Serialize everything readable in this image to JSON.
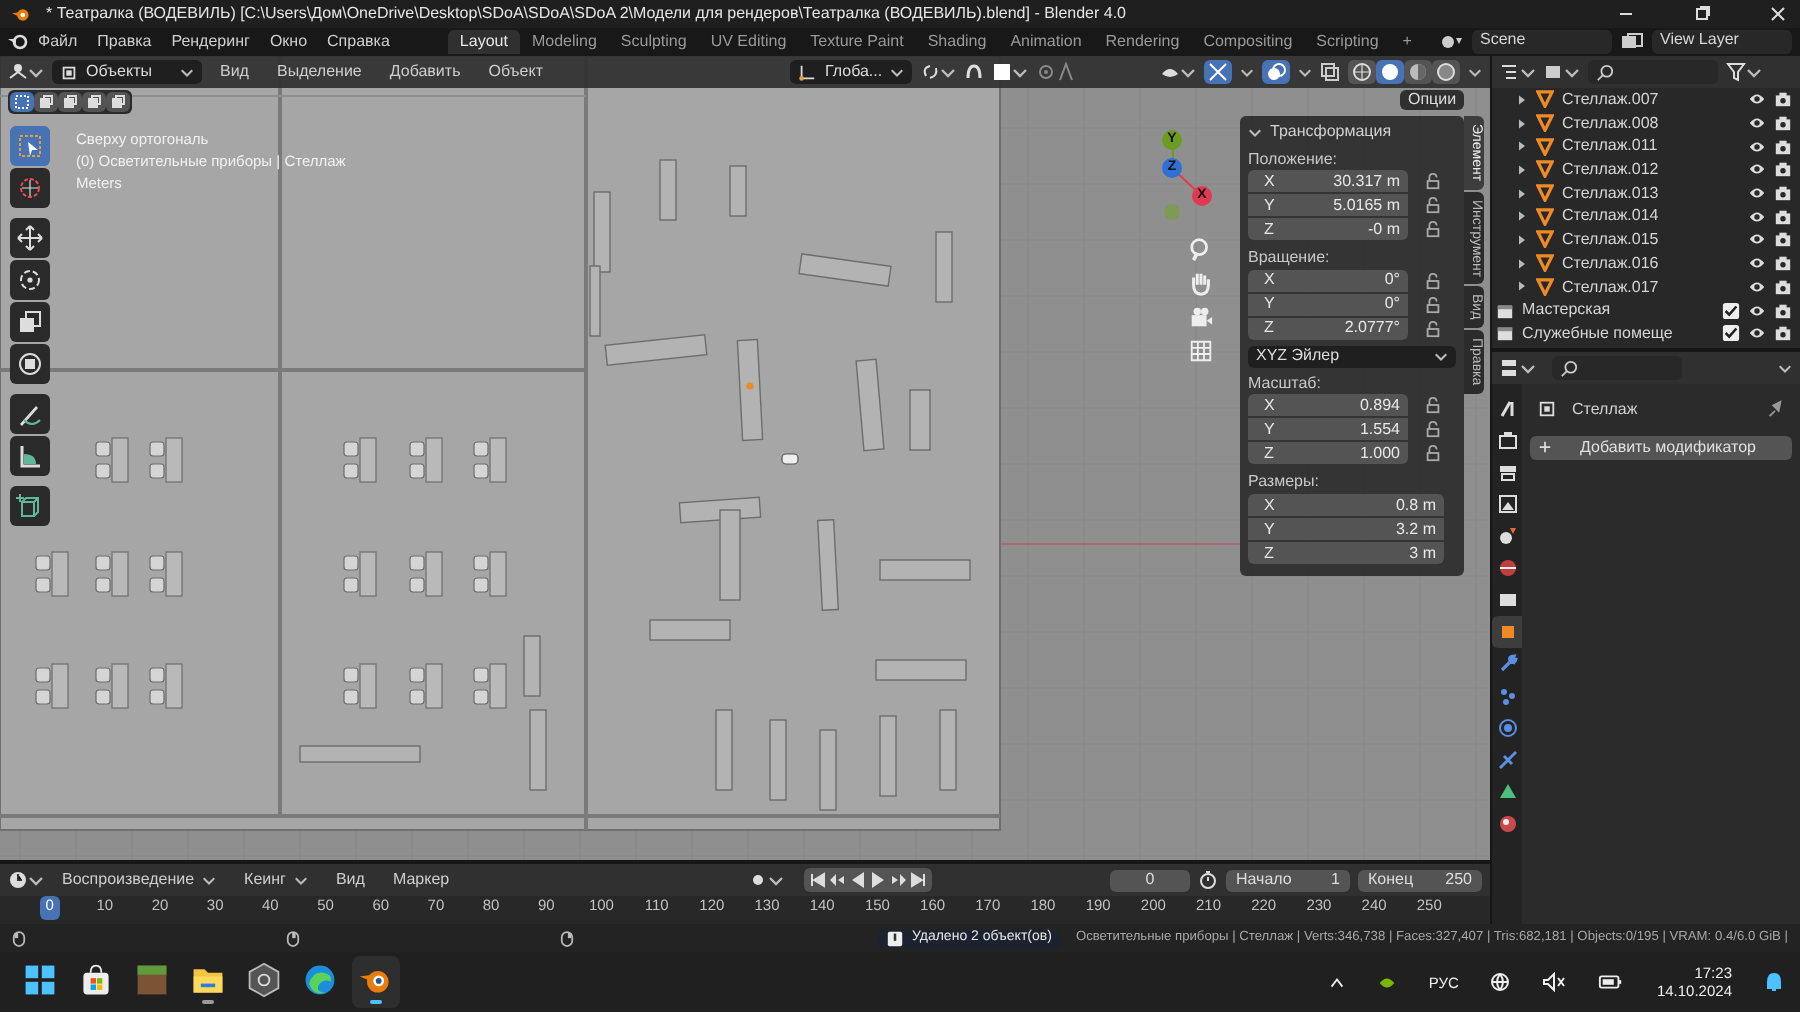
{
  "window": {
    "title": "* Театралка (ВОДЕВИЛЬ) [C:\\Users\\Дом\\OneDrive\\Desktop\\SDoA\\SDoA\\SDoA 2\\Модели для рендеров\\Театралка (ВОДЕВИЛЬ).blend] - Blender 4.0"
  },
  "menu": [
    "Файл",
    "Правка",
    "Рендеринг",
    "Окно",
    "Справка"
  ],
  "workspaces": [
    {
      "label": "Layout",
      "selected": true
    },
    {
      "label": "Modeling",
      "selected": false
    },
    {
      "label": "Sculpting",
      "selected": false
    },
    {
      "label": "UV Editing",
      "selected": false
    },
    {
      "label": "Texture Paint",
      "selected": false
    },
    {
      "label": "Shading",
      "selected": false
    },
    {
      "label": "Animation",
      "selected": false
    },
    {
      "label": "Rendering",
      "selected": false
    },
    {
      "label": "Compositing",
      "selected": false
    },
    {
      "label": "Scripting",
      "selected": false
    }
  ],
  "add_workspace": "+",
  "scene": {
    "name": "Scene"
  },
  "view_layer": {
    "name": "View Layer"
  },
  "viewport": {
    "mode": "Объекты",
    "menu": [
      "Вид",
      "Выделение",
      "Добавить",
      "Объект"
    ],
    "orientation": "Глоба...",
    "options": "Опции",
    "select_modes": [
      {
        "selected": true
      },
      {
        "selected": false
      },
      {
        "selected": false
      },
      {
        "selected": false
      },
      {
        "selected": false
      }
    ],
    "shading": [
      {
        "selected": false
      },
      {
        "selected": true
      },
      {
        "selected": false
      },
      {
        "selected": false
      }
    ],
    "overlay_text": [
      "Сверху ортогональ",
      "(0) Осветительные приборы | Стеллаж",
      "Meters"
    ],
    "tools": [
      {
        "selected": true
      },
      {
        "selected": false
      },
      {
        "selected": false
      },
      {
        "selected": false
      },
      {
        "selected": false
      },
      {
        "selected": false
      },
      {
        "selected": false
      },
      {
        "selected": false
      },
      {
        "selected": false
      }
    ],
    "gizmo_axes": [
      {
        "label": "Y",
        "color": "#6c9b22"
      },
      {
        "label": "Z",
        "color": "#2f6fd6"
      },
      {
        "label": "X",
        "color": "#e03a52"
      }
    ]
  },
  "n_panel": {
    "tabs": [
      {
        "label": "Элемент",
        "selected": true
      },
      {
        "label": "Инструмент",
        "selected": false
      },
      {
        "label": "Вид",
        "selected": false
      },
      {
        "label": "Правка",
        "selected": false
      }
    ],
    "title": "Трансформация",
    "sections": [
      {
        "label": "Положение:",
        "lockable": true,
        "fields": [
          {
            "axis": "X",
            "value": "30.317 m"
          },
          {
            "axis": "Y",
            "value": "5.0165 m"
          },
          {
            "axis": "Z",
            "value": "-0 m"
          }
        ]
      },
      {
        "label": "Вращение:",
        "lockable": true,
        "fields": [
          {
            "axis": "X",
            "value": "0°"
          },
          {
            "axis": "Y",
            "value": "0°"
          },
          {
            "axis": "Z",
            "value": "2.0777°"
          }
        ],
        "rotation_mode": "XYZ Эйлер"
      },
      {
        "label": "Масштаб:",
        "lockable": true,
        "fields": [
          {
            "axis": "X",
            "value": "0.894"
          },
          {
            "axis": "Y",
            "value": "1.554"
          },
          {
            "axis": "Z",
            "value": "1.000"
          }
        ]
      },
      {
        "label": "Размеры:",
        "lockable": false,
        "fields": [
          {
            "axis": "X",
            "value": "0.8 m"
          },
          {
            "axis": "Y",
            "value": "3.2 m"
          },
          {
            "axis": "Z",
            "value": "3 m"
          }
        ]
      }
    ]
  },
  "outliner": {
    "items": [
      {
        "kind": "mesh",
        "name": "Стеллаж.007",
        "expanded": false
      },
      {
        "kind": "mesh",
        "name": "Стеллаж.008",
        "expanded": false
      },
      {
        "kind": "mesh",
        "name": "Стеллаж.011",
        "expanded": false
      },
      {
        "kind": "mesh",
        "name": "Стеллаж.012",
        "expanded": false
      },
      {
        "kind": "mesh",
        "name": "Стеллаж.013",
        "expanded": false
      },
      {
        "kind": "mesh",
        "name": "Стеллаж.014",
        "expanded": false
      },
      {
        "kind": "mesh",
        "name": "Стеллаж.015",
        "expanded": false
      },
      {
        "kind": "mesh",
        "name": "Стеллаж.016",
        "expanded": false
      },
      {
        "kind": "mesh",
        "name": "Стеллаж.017",
        "expanded": false
      },
      {
        "kind": "collection",
        "name": "Мастерская",
        "checked": true
      },
      {
        "kind": "collection",
        "name": "Служебные помеще",
        "checked": true
      }
    ]
  },
  "properties": {
    "tabs": [
      {
        "selected": false
      },
      {
        "selected": false
      },
      {
        "selected": false
      },
      {
        "selected": false
      },
      {
        "selected": false
      },
      {
        "selected": false
      },
      {
        "selected": false
      },
      {
        "selected": true
      },
      {
        "selected": false
      },
      {
        "selected": false
      },
      {
        "selected": false
      },
      {
        "selected": false
      },
      {
        "selected": false
      },
      {
        "selected": false
      }
    ],
    "object": "Стеллаж",
    "add_button": "Добавить модификатор"
  },
  "timeline": {
    "menu": [
      "Воспроизведение",
      "Кеинг",
      "Вид",
      "Маркер"
    ],
    "current_frame": "0",
    "start_label": "Начало",
    "start": "1",
    "end_label": "Конец",
    "end": "250",
    "playhead": "0",
    "ticks": [
      "10",
      "20",
      "30",
      "40",
      "50",
      "60",
      "70",
      "80",
      "90",
      "100",
      "110",
      "120",
      "130",
      "140",
      "150",
      "160",
      "170",
      "180",
      "190",
      "200",
      "210",
      "220",
      "230",
      "240",
      "250"
    ]
  },
  "status": {
    "message": "Удалено 2 объект(ов)",
    "stats": "Осветительные приборы | Стеллаж | Verts:346,738 | Faces:327,407 | Tris:682,181 | Objects:0/195 | VRAM: 0.4/6.0 GiB |"
  },
  "taskbar": {
    "apps": [
      {
        "kind": "start",
        "running": false,
        "active": false
      },
      {
        "kind": "store",
        "running": false,
        "active": false
      },
      {
        "kind": "game",
        "running": false,
        "active": false
      },
      {
        "kind": "files",
        "running": true,
        "active": false
      },
      {
        "kind": "hexapp",
        "running": false,
        "active": false
      },
      {
        "kind": "browser",
        "running": false,
        "active": false
      },
      {
        "kind": "blender",
        "running": true,
        "active": true
      }
    ],
    "language": "РУС",
    "time": "17:23",
    "date": "14.10.2024"
  }
}
